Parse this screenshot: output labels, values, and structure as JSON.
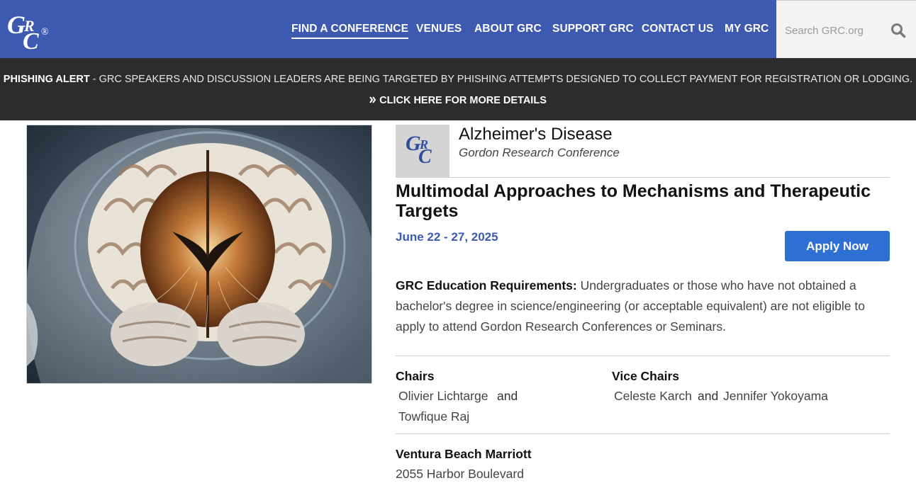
{
  "header": {
    "logo_text": "GRC®",
    "nav": [
      {
        "label": "FIND A CONFERENCE",
        "active": true
      },
      {
        "label": "VENUES"
      },
      {
        "label": "ABOUT GRC"
      },
      {
        "label": "SUPPORT GRC"
      },
      {
        "label": "CONTACT US"
      },
      {
        "label": "MY GRC"
      }
    ],
    "search_placeholder": "Search GRC.org",
    "search_icon": "search-icon",
    "brand_color": "#3d5ab0"
  },
  "alert": {
    "label": "PHISHING ALERT",
    "message": " - GRC SPEAKERS AND DISCUSSION LEADERS ARE BEING TARGETED BY PHISHING ATTEMPTS DESIGNED TO COLLECT PAYMENT FOR REGISTRATION OR LODGING.",
    "link": "CLICK HERE FOR MORE DETAILS",
    "link_icon": "double-chevron-right-icon"
  },
  "conference": {
    "name": "Alzheimer's Disease",
    "type": "Gordon Research Conference",
    "title": "Multimodal Approaches to Mechanisms and Therapeutic Targets",
    "dates": "June 22 - 27, 2025",
    "apply_label": "Apply Now",
    "education_label": "GRC Education Requirements:",
    "education_text": " Undergraduates or those who have not obtained a bachelor's degree in science/engineering (or acceptable equivalent) are not eligible to apply to attend Gordon Research Conferences or Seminars.",
    "chairs_label": "Chairs",
    "chairs": [
      "Olivier Lichtarge",
      "Towfique Raj"
    ],
    "vice_chairs_label": "Vice Chairs",
    "vice_chairs": [
      "Celeste Karch",
      "Jennifer Yokoyama"
    ],
    "and_word": "and",
    "venue_name": "Ventura Beach Marriott",
    "venue_address": "2055 Harbor Boulevard",
    "accent_color": "#2e6fd3"
  }
}
